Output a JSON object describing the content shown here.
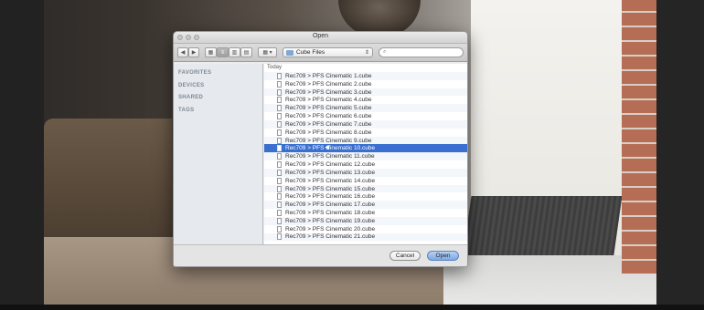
{
  "dialog": {
    "title": "Open",
    "path_popup": "Cube Files",
    "search_placeholder": "",
    "sidebar": [
      "FAVORITES",
      "DEVICES",
      "SHARED",
      "TAGS"
    ],
    "list_group": "Today",
    "files": [
      "Rec709 > PFS Cinematic 1.cube",
      "Rec709 > PFS Cinematic 2.cube",
      "Rec709 > PFS Cinematic 3.cube",
      "Rec709 > PFS Cinematic 4.cube",
      "Rec709 > PFS Cinematic 5.cube",
      "Rec709 > PFS Cinematic 6.cube",
      "Rec709 > PFS Cinematic 7.cube",
      "Rec709 > PFS Cinematic 8.cube",
      "Rec709 > PFS Cinematic 9.cube",
      "Rec709 > PFS Cinematic 10.cube",
      "Rec709 > PFS Cinematic 11.cube",
      "Rec709 > PFS Cinematic 12.cube",
      "Rec709 > PFS Cinematic 13.cube",
      "Rec709 > PFS Cinematic 14.cube",
      "Rec709 > PFS Cinematic 15.cube",
      "Rec709 > PFS Cinematic 16.cube",
      "Rec709 > PFS Cinematic 17.cube",
      "Rec709 > PFS Cinematic 18.cube",
      "Rec709 > PFS Cinematic 19.cube",
      "Rec709 > PFS Cinematic 20.cube",
      "Rec709 > PFS Cinematic 21.cube"
    ],
    "selected_index": 9,
    "cancel_label": "Cancel",
    "open_label": "Open",
    "toolbar_icons": [
      "back-icon",
      "forward-icon",
      "icon-view-icon",
      "list-view-icon",
      "column-view-icon",
      "coverflow-view-icon",
      "arrange-menu-icon"
    ]
  },
  "colors": {
    "selection": "#3a6fd0",
    "sidebar_bg": "#e6eaef",
    "default_button": "#7ca8e2"
  }
}
